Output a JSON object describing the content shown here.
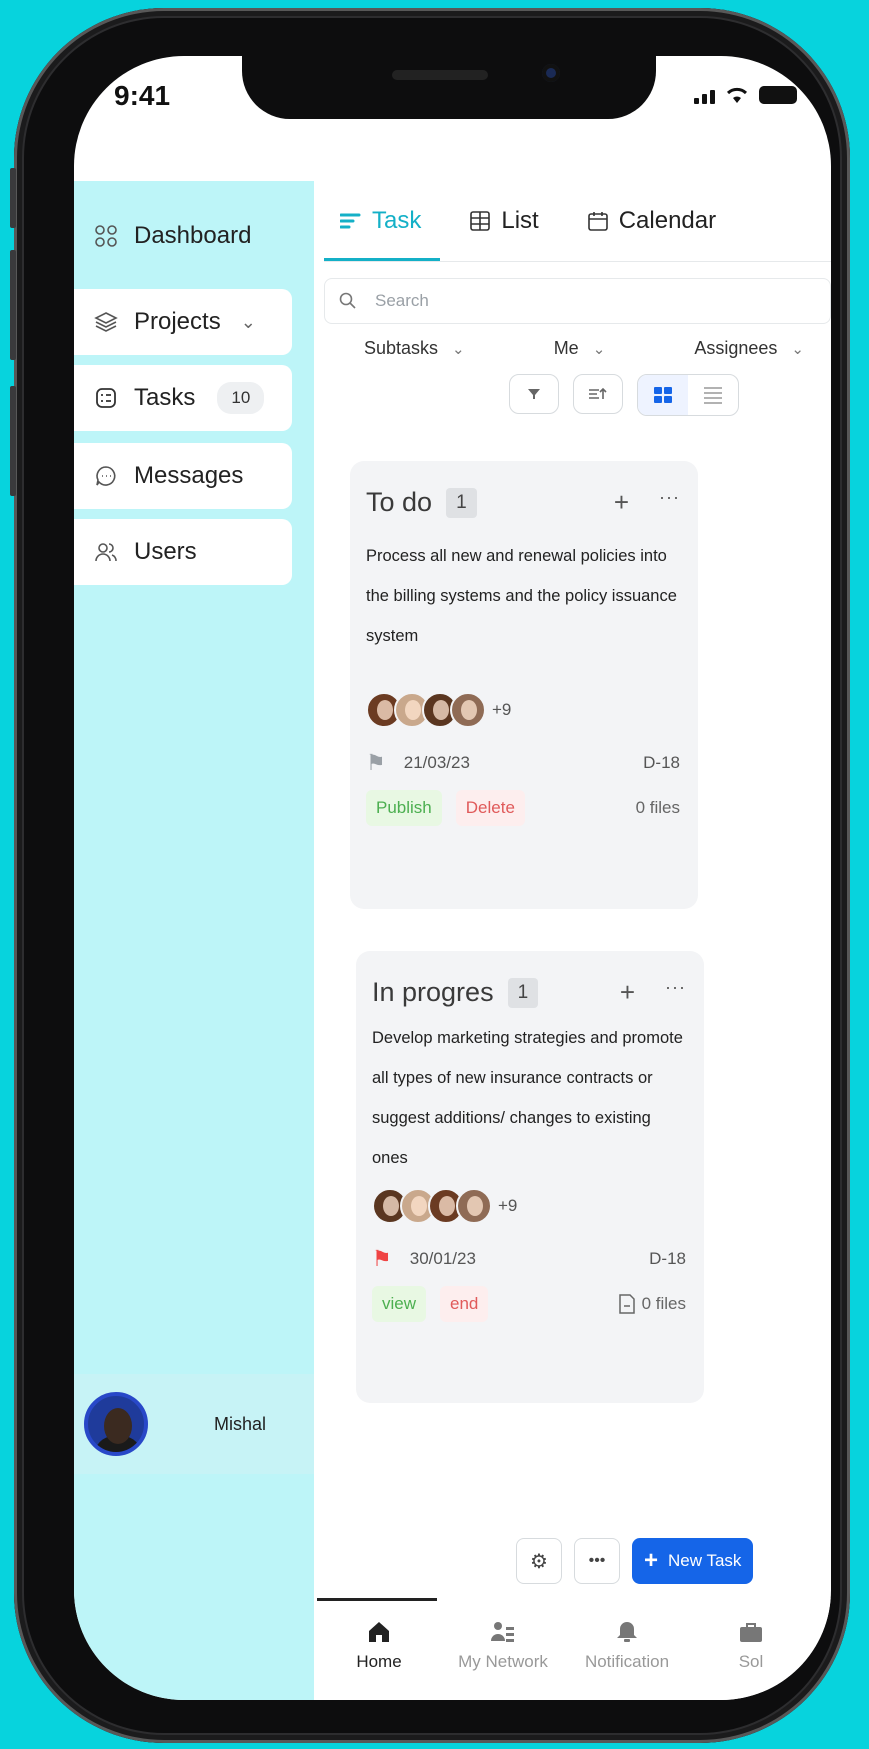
{
  "status_bar": {
    "time": "9:41"
  },
  "sidebar": {
    "items": [
      {
        "label": "Dashboard",
        "icon": "dashboard-grid-icon"
      },
      {
        "label": "Projects",
        "icon": "layers-icon"
      },
      {
        "label": "Tasks",
        "icon": "tasks-icon",
        "badge": "10"
      },
      {
        "label": "Messages",
        "icon": "chat-bubble-icon"
      },
      {
        "label": "Users",
        "icon": "users-icon"
      }
    ],
    "theme_light_icon": "sun-icon",
    "theme_dark_icon": "moon-icon",
    "user_name": "Mishal"
  },
  "tabs": [
    {
      "label": "Task",
      "active": true
    },
    {
      "label": "List"
    },
    {
      "label": "Calendar"
    }
  ],
  "search": {
    "placeholder": "Search"
  },
  "filters": {
    "subtasks": "Subtasks",
    "me": "Me",
    "assignees": "Assignees"
  },
  "columns": [
    {
      "title": "To do",
      "count": "1",
      "description": "Process all new and renewal policies into the billing systems and the policy issuance system",
      "extra_avatars": "+9",
      "date": "21/03/23",
      "code": "D-18",
      "action1": "Publish",
      "action2": "Delete",
      "files": "0 files",
      "flag_color": "#9aa0a6"
    },
    {
      "title": "In progres",
      "count": "1",
      "description": "Develop marketing strategies and promote all types of new insurance contracts or suggest additions/ changes to existing ones",
      "extra_avatars": "+9",
      "date": "30/01/23",
      "code": "D-18",
      "action1": "view",
      "action2": "end",
      "files": "0 files",
      "flag_color": "#ef4444"
    }
  ],
  "bottom_actions": {
    "new_task": "New Task"
  },
  "bottom_nav": [
    {
      "label": "Home",
      "active": true
    },
    {
      "label": "My Network"
    },
    {
      "label": "Notification"
    },
    {
      "label": "Sol"
    }
  ],
  "colors": {
    "background": "#07d3dd",
    "sidebar": "#bdf5f8",
    "accent": "#14b0c7",
    "primary_button": "#1565e8"
  }
}
